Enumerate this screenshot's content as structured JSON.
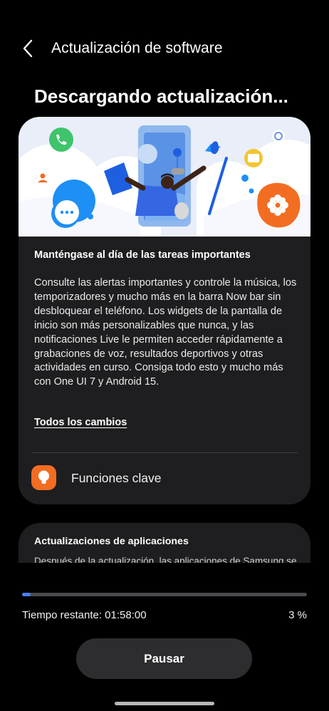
{
  "header": {
    "title": "Actualización de software"
  },
  "status_title": "Descargando actualización...",
  "card": {
    "heading": "Manténgase al día de las tareas importantes",
    "body": "Consulte las alertas importantes y controle la música, los temporizadores y mucho más en la barra Now bar sin desbloquear el teléfono. Los widgets de la pantalla de inicio son más personalizables que nunca, y las notificaciones Live le permiten acceder rápidamente a grabaciones de voz, resultados deportivos y otras actividades en curso. Consiga todo esto y mucho más con One UI 7 y Android 15.",
    "all_changes": "Todos los cambios",
    "key_features": {
      "label": "Funciones clave",
      "icon": "lightbulb-icon",
      "color": "#f26d22"
    }
  },
  "card2": {
    "title": "Actualizaciones de aplicaciones",
    "body": "Después de la actualización, las aplicaciones de Samsung se"
  },
  "download": {
    "progress_percent": 3,
    "time_remaining": "Tiempo restante: 01:58:00",
    "percent_label": "3 %"
  },
  "pause_button": {
    "label": "Pausar"
  },
  "colors": {
    "accent": "#4a7ff0",
    "card_bg": "#1e1e20",
    "orange": "#f26d22"
  }
}
